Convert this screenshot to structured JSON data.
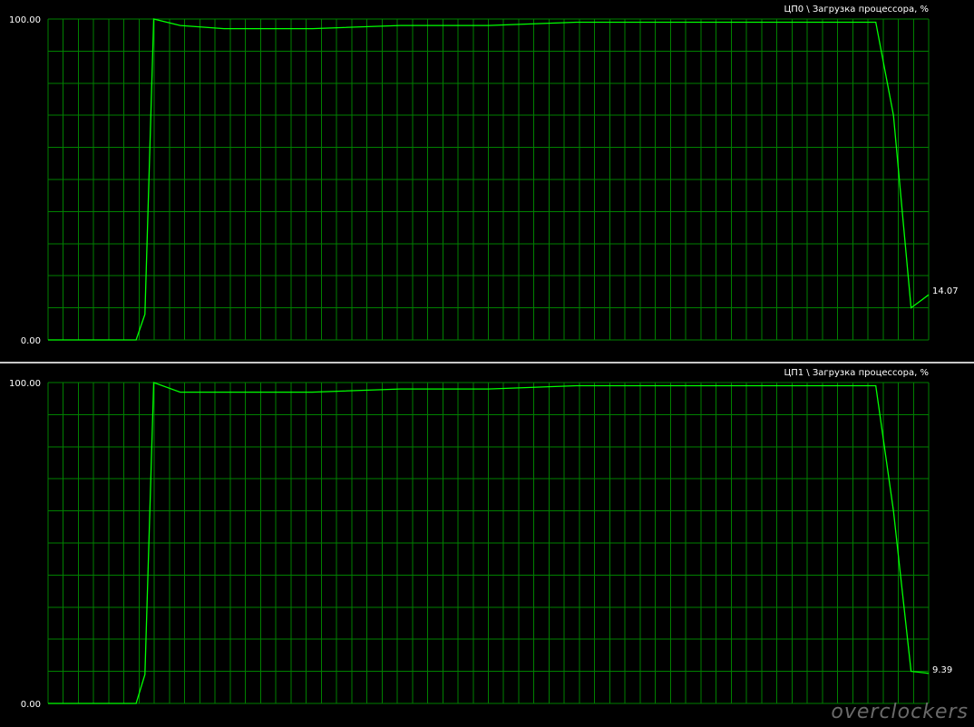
{
  "watermark": "overclockers",
  "colors": {
    "background": "#000000",
    "grid": "#008000",
    "trace": "#00ff00",
    "text": "#ffffff"
  },
  "chart_data": [
    {
      "type": "line",
      "title": "ЦП0 \\ Загрузка процессора, %",
      "ylim": [
        0,
        100
      ],
      "ytick_labels": [
        "100.00",
        "0.00"
      ],
      "current_value_label": "14.07",
      "grid": true,
      "series": [
        {
          "x": [
            0,
            2,
            4,
            6,
            8,
            10,
            11,
            12,
            15,
            20,
            30,
            40,
            50,
            60,
            70,
            80,
            90,
            94,
            96,
            98,
            100
          ],
          "y": [
            0,
            0,
            0,
            0,
            0,
            0,
            8,
            100,
            98,
            97,
            97,
            98,
            98,
            99,
            99,
            99,
            99,
            99,
            70,
            10,
            14.07
          ]
        }
      ]
    },
    {
      "type": "line",
      "title": "ЦП1 \\ Загрузка процессора, %",
      "ylim": [
        0,
        100
      ],
      "ytick_labels": [
        "100.00",
        "0.00"
      ],
      "current_value_label": "9.39",
      "grid": true,
      "series": [
        {
          "x": [
            0,
            2,
            4,
            6,
            8,
            10,
            11,
            12,
            15,
            20,
            30,
            40,
            50,
            60,
            70,
            80,
            90,
            94,
            96,
            98,
            100
          ],
          "y": [
            0,
            0,
            0,
            0,
            0,
            0,
            9,
            100,
            97,
            97,
            97,
            98,
            98,
            99,
            99,
            99,
            99,
            99,
            60,
            10,
            9.39
          ]
        }
      ]
    }
  ]
}
